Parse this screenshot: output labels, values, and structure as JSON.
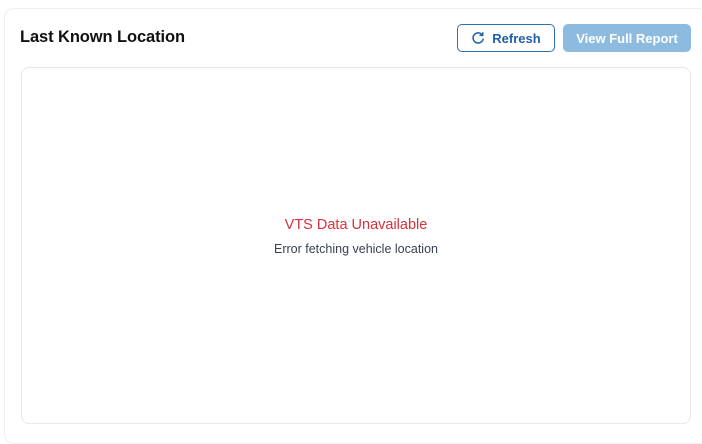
{
  "card": {
    "title": "Last Known Location"
  },
  "actions": {
    "refresh_label": "Refresh",
    "refresh_icon": "refresh-icon",
    "report_label": "View Full Report"
  },
  "status": {
    "title": "VTS Data Unavailable",
    "message": "Error fetching vehicle location"
  },
  "colors": {
    "primary": "#1f5fa8",
    "disabled_button": "#8dbbe0",
    "error": "#d6313c"
  }
}
